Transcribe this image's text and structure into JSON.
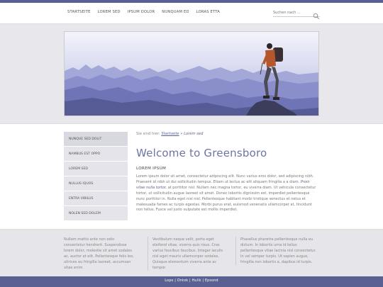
{
  "nav": {
    "items": [
      "Startseite",
      "Lorem sed",
      "Ipsum dolor",
      "Nunquam ed",
      "Loras Etta"
    ]
  },
  "search": {
    "placeholder": "Suchen nach ..."
  },
  "sidebar": {
    "items": [
      "Nunque sed dolit",
      "Nambus est oppo",
      "Lorem sed",
      "Nullus iquos",
      "Entra Vibilus",
      "Nolen sed dolem"
    ]
  },
  "breadcrumb": {
    "prefix": "Sie sind hier:",
    "link": "Startseite",
    "separator": "»",
    "current": "Lorem sed"
  },
  "main": {
    "title": "Welcome to Greensboro",
    "subtitle": "LOREM IPSUM",
    "text_1": "Lorem ipsum dolor sit amet, consectetur adipiscing elit. Nunc varius eros dolor, sed adipiscing nibh. Praesent id nibh ut dui sollicitudin tempus. Etiam ut lectus ac elit aliquam fringilla a a diam.",
    "text_italic": "Proin vitae nulla tortor,",
    "text_2": "at porttitor nisl. Nullam nec magna tortor, eu viverra diam. Ut vehicula consectetur tortor, ut sollicitudin augue laoreet sit amet. Donec lobortis dignissim est, imperdiet pellentesque nunc porttitor in. Nulla eget nisl nisl. Pellentesque habitant morbi tristique senectus et netus et malesuada fames ac turpis egestas. Morbi purus erat, euismod venenatis ullamcorper at, tincidunt non tellus. Fusce vel justo vulputate est mollis imperdiet."
  },
  "footer": {
    "col1": "Nullam mattis ante non odio consectetur hendrerit. Suspendisse lorem dolor, molestie sit amet sodales ac, auctor et elit. Pellentesque felis leo, ultrices eu fringilla laoreet, accumsan vitae enim",
    "col2": "Vestibulum neque velit, porta eget eleifend vitae, viverra quis risus. Cras varius faucibus faucibus. Integer iaculis nisl eget mauris ullamcorper sodales. Quisque elementum viverra ante ac tempor.",
    "col3": "Phasellus pharetra pellentesque nulla eu dictum. In lobortis urna id tellus pellentesque vitae lacinia nisl consectetur. In vel semper turpis. Ut sapien augue, fringilla non lobortis a, dapibus id turpis."
  },
  "bottom_links": [
    "Lopo",
    "Ontok",
    "Hulik",
    "Epsond"
  ],
  "colors": {
    "accent": "#5a6192",
    "title": "#6d74a6"
  }
}
